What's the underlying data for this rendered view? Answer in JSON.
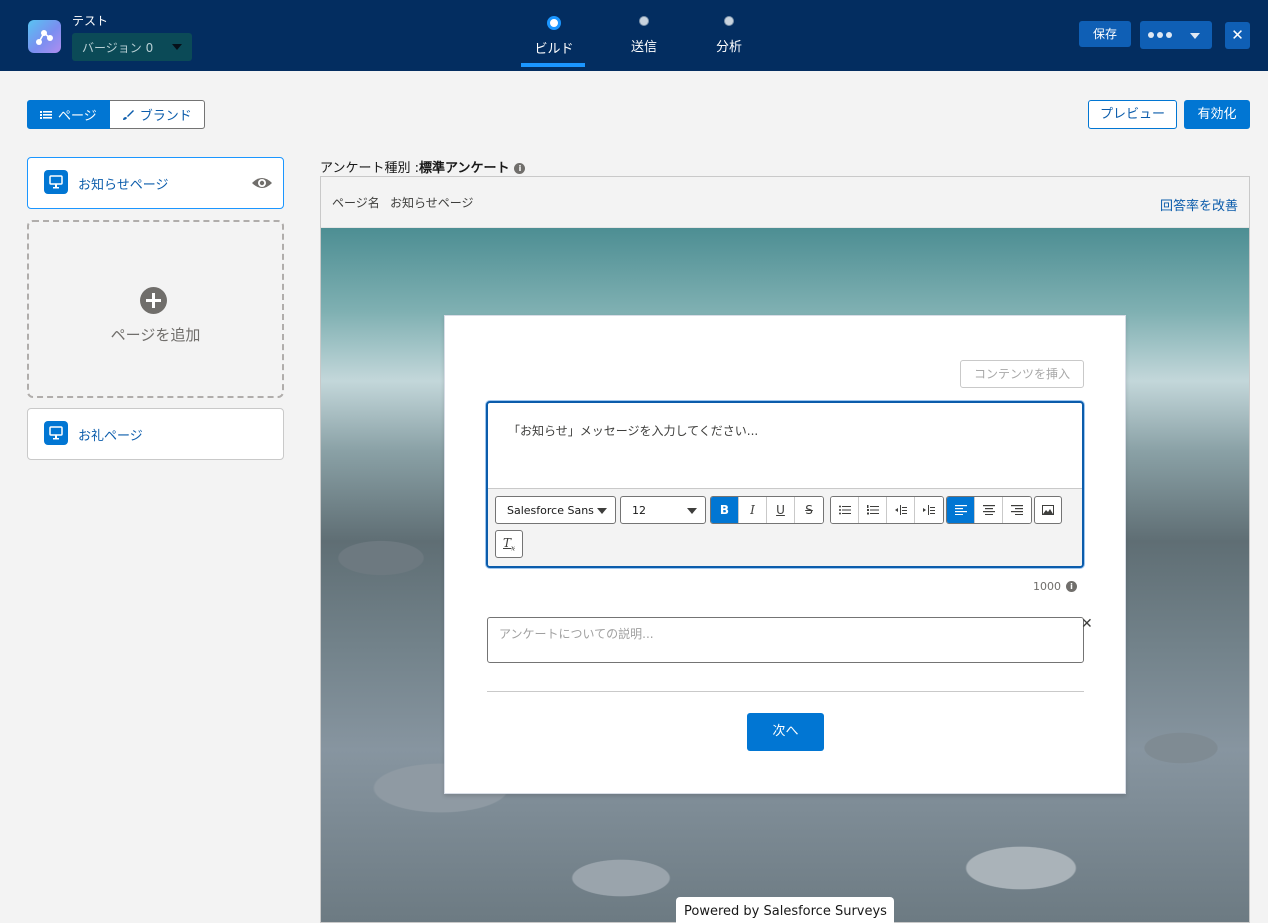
{
  "header": {
    "app_title": "テスト",
    "version": "バージョン 0",
    "steps": [
      {
        "label": "ビルド",
        "active": true
      },
      {
        "label": "送信",
        "active": false
      },
      {
        "label": "分析",
        "active": false
      }
    ],
    "save_label": "保存",
    "close_glyph": "✕"
  },
  "toolbar": {
    "page_tab": "ページ",
    "brand_tab": "ブランド",
    "preview_label": "プレビュー",
    "activate_label": "有効化"
  },
  "sidebar": {
    "pages": [
      {
        "label": "お知らせページ"
      },
      {
        "label": "お礼ページ"
      }
    ],
    "add_page_label": "ページを追加"
  },
  "survey": {
    "type_label": "アンケート種別 : ",
    "type_value": "標準アンケート",
    "page_name_label": "ページ名",
    "page_name_value": "お知らせページ",
    "improve_label": "回答率を改善",
    "insert_content": "コンテンツを挿入",
    "welcome_placeholder": "「お知らせ」メッセージを入力してください...",
    "font_family": "Salesforce Sans",
    "font_size": "12",
    "char_limit": "1000",
    "description_placeholder": "アンケートについての説明...",
    "next_label": "次へ"
  },
  "footer": {
    "powered_prefix": "Powered by ",
    "powered_brand": "Salesforce Surveys"
  },
  "colors": {
    "header_bg": "#032d60",
    "brand_blue": "#0176d3",
    "accent": "#1b96ff"
  }
}
